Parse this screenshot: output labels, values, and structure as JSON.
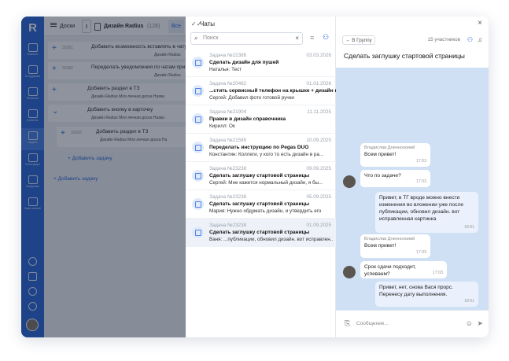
{
  "sidebar": {
    "logo": "R",
    "items": [
      {
        "label": "Новости"
      },
      {
        "label": "Сотрудники"
      },
      {
        "label": "Финансы"
      },
      {
        "label": "Клиенты"
      },
      {
        "label": "Задачи"
      },
      {
        "label": "Календарь"
      },
      {
        "label": "Академия"
      },
      {
        "label": "База знаний"
      }
    ]
  },
  "board": {
    "boards_label": "Доски",
    "project_name": "Дизайн Radius",
    "project_count": "(128)",
    "filter_label": "Все",
    "tasks": [
      {
        "num": "32981",
        "title": "Добавить возможность вставлять в чату",
        "tag": "Дизайн Radius"
      },
      {
        "num": "32982",
        "title": "Переделать уведомления по чатам при до",
        "tag": "Дизайн Radius"
      },
      {
        "num": "",
        "title": "Добавить раздел в ТЗ",
        "tag": "Дизайн Radius   Моя личная доска   Назва"
      },
      {
        "num": "",
        "title": "Добавить кнопку в карточку",
        "tag": "Дизайн Radius   Моя личная доска   Назва"
      },
      {
        "num": "32982",
        "title": "Добавить раздел в ТЗ",
        "tag": "Дизайн Radius   Моя личная доска   На"
      }
    ],
    "add_task": "Добавить задачу"
  },
  "chats": {
    "title": "Чаты",
    "search_placeholder": "Поиск",
    "items": [
      {
        "num": "Задача №22386",
        "date": "03.03.2026",
        "title": "Сделать дизайн для пушей",
        "message": "Наталья: Тест"
      },
      {
        "num": "Задача №20462",
        "date": "01.01.2026",
        "title": "...стить сервисный телефон на крышке + дизайн к...",
        "message": "Сергей: Добавил фото готовой ручки"
      },
      {
        "num": "Задача №21904",
        "date": "11.11.2025",
        "title": "Правки в дизайн справочника",
        "message": "Кирилл: Ок"
      },
      {
        "num": "Задача №21585",
        "date": "10.09.2025",
        "title": "Переделать инструкцию по Pegas DUO",
        "message": "Константин: Коллеги, у кого то есть дизайн в ра..."
      },
      {
        "num": "Задача №23238",
        "date": "09.09.2025",
        "title": "Сделать заглушку стартовой страницы",
        "message": "Сергей: Мне кажется нормальный дизайн, я бы..."
      },
      {
        "num": "Задача №23238",
        "date": "05.09.2025",
        "title": "Сделать заглушку стартовой страницы",
        "message": "Мария: Нужно обдумать дизайн, и утвердить его"
      },
      {
        "num": "Задача №23238",
        "date": "01.09.2025",
        "title": "Сделать заглушку стартовой страницы",
        "message": "Ваня: ...публикации, обновил дизайн. вот исправлен..."
      }
    ]
  },
  "conversation": {
    "back_label": "В Группу",
    "members": "15 участников",
    "title": "Сделать заглушку стартовой страницы",
    "messages": [
      {
        "who": "Владислав Длинноноиий",
        "text": "Всем привет!",
        "time": "17:03"
      },
      {
        "who": "",
        "text": "Что по задаче?",
        "time": "17:03"
      },
      {
        "who": "",
        "text": "Привет, в ТГ вроде можно внести изменения во вложении уже после публикации, обновил дизайн. вот исправленная картинка",
        "time": "18:01"
      },
      {
        "who": "Владислав Длинноноиий",
        "text": "Всем привет!",
        "time": "17:03"
      },
      {
        "who": "",
        "text": "Срок сдачи подходит, успеваем?",
        "time": "17:03"
      },
      {
        "who": "",
        "text": "Привет, нет, снова Вася прорс. Перенесу дату выполнения.",
        "time": "18:01"
      }
    ],
    "input_placeholder": "Сообщение..."
  }
}
